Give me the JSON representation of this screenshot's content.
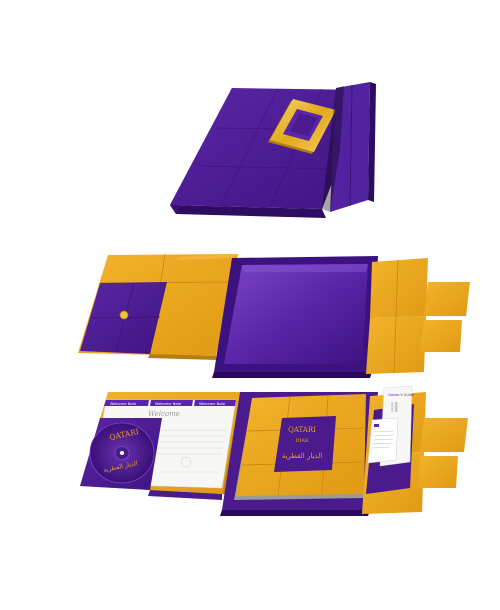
{
  "colors": {
    "purple": "#4b1a8c",
    "purple_dark": "#35106a",
    "purple_light": "#6a35b0",
    "gold": "#e8a51e",
    "gold_dark": "#c9860e",
    "gold_light": "#f4c24a",
    "paper": "#f7f7f5",
    "background": "#ffffff"
  },
  "branding": {
    "wordmark": "QATARI",
    "wordmark_sub": "DIAR",
    "arabic": "الديار القطرية"
  },
  "booklet": {
    "tab_labels": [
      "Welcome Note",
      "Welcome Note",
      "Welcome Note"
    ],
    "heading": "Welcome"
  },
  "card": {
    "heading": "Owner's Guide"
  }
}
